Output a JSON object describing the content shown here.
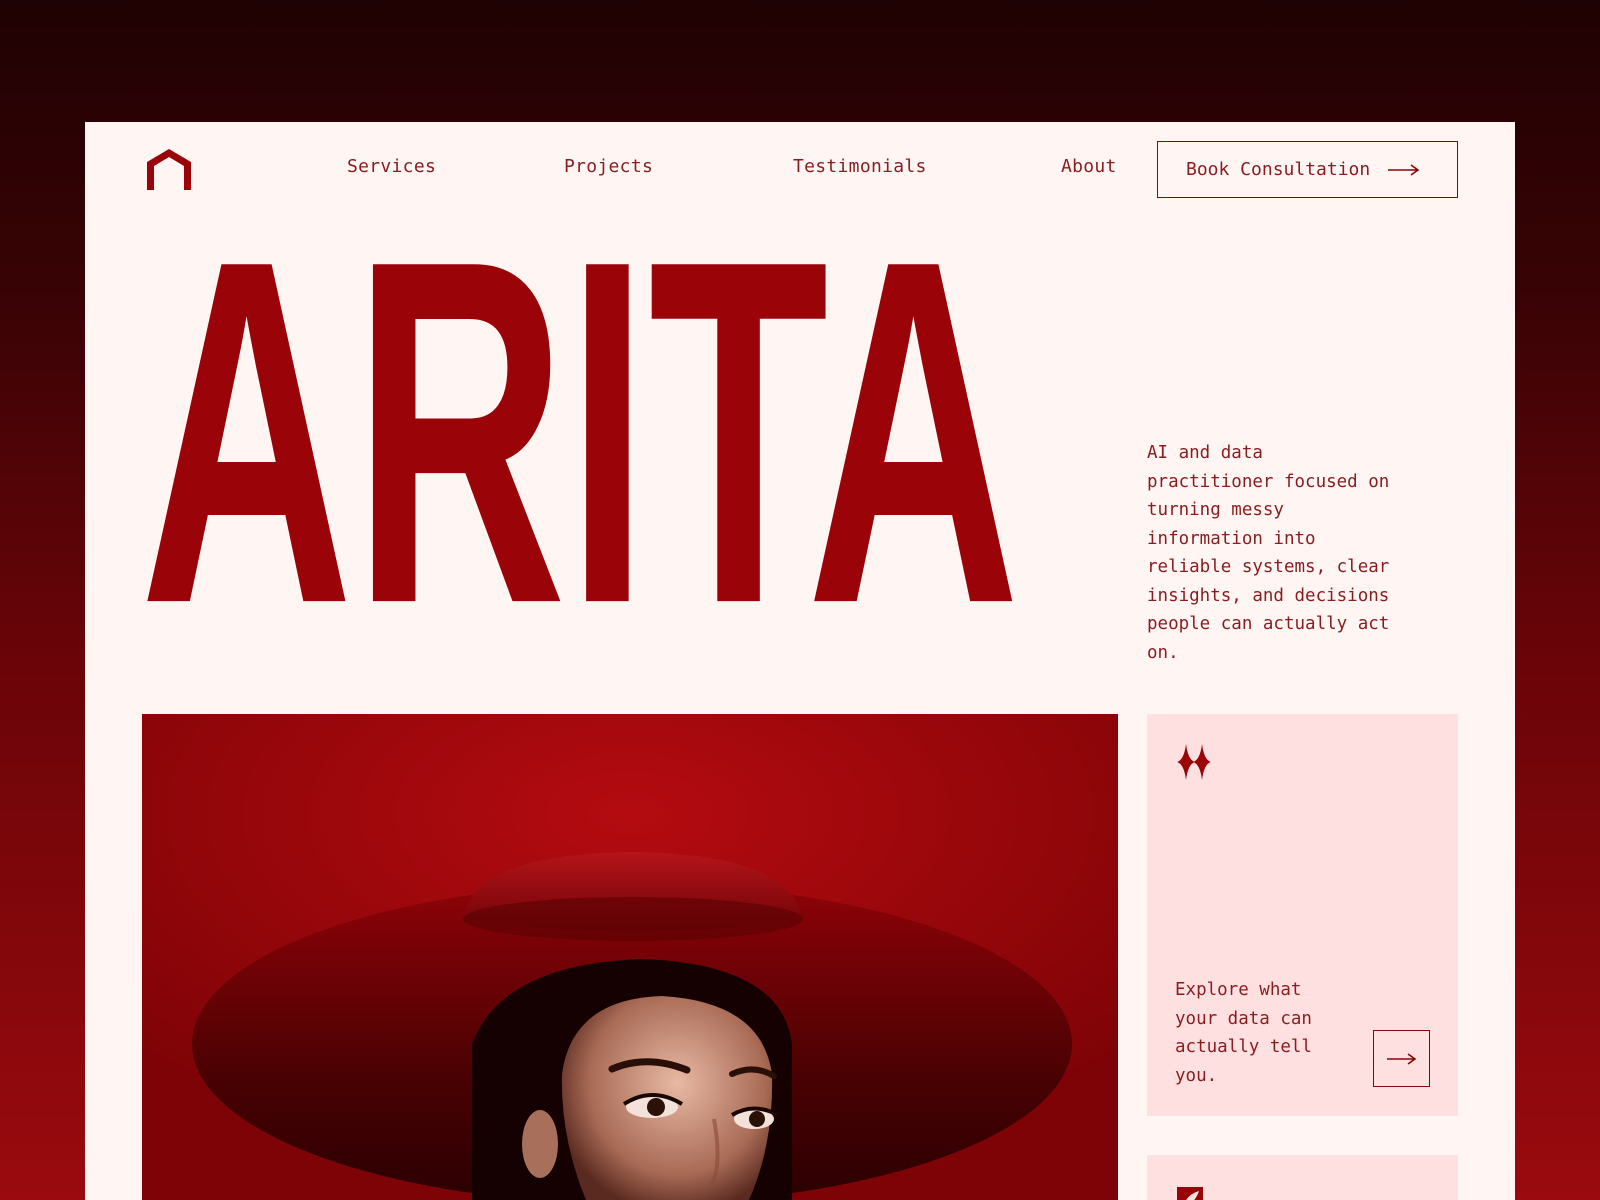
{
  "brand": {
    "logo_icon": "arch-house-icon",
    "color": "#9a0408"
  },
  "nav": {
    "items": [
      {
        "label": "Services"
      },
      {
        "label": "Projects"
      },
      {
        "label": "Testimonials"
      },
      {
        "label": "About"
      }
    ],
    "cta_label": "Book Consultation",
    "cta_icon": "arrow-right-icon"
  },
  "hero": {
    "title": "ARITA",
    "description": "AI and data practitioner focused on turning messy information into reliable systems, clear insights, and decisions people can actually act on."
  },
  "portrait": {
    "alt": "Portrait of a woman in a wide-brimmed red hat",
    "accent": "#9a0508"
  },
  "cards": [
    {
      "icon": "sparkle-icon",
      "text": "Explore what your data can actually tell you.",
      "button_icon": "arrow-right-icon",
      "background": "#ffe0e0"
    },
    {
      "icon": "leaf-icon",
      "background": "#ffe0e0"
    }
  ],
  "colors": {
    "primary": "#9a0408",
    "text": "#8a1c1f",
    "page_bg": "#fff5f3"
  }
}
